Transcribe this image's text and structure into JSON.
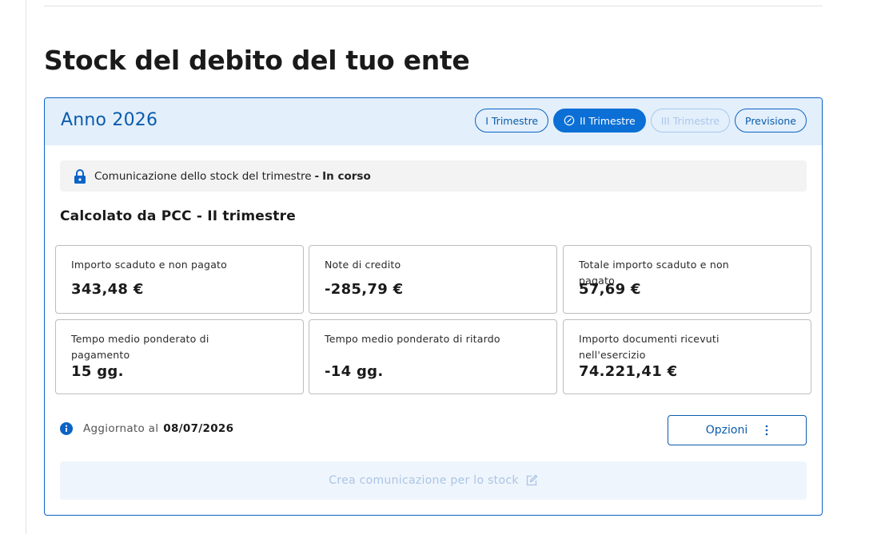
{
  "page": {
    "title": "Stock del debito del tuo ente"
  },
  "card": {
    "year_title": "Anno 2026",
    "tabs": [
      {
        "label": "I Trimestre",
        "state": "default"
      },
      {
        "label": "II Trimestre",
        "state": "active"
      },
      {
        "label": "III Trimestre",
        "state": "disabled"
      },
      {
        "label": "Previsione",
        "state": "default"
      }
    ]
  },
  "status": {
    "text": "Comunicazione dello stock del trimestre",
    "separator": "-",
    "state": "In corso",
    "icon": "lock-icon"
  },
  "section": {
    "title": "Calcolato da PCC - II trimestre"
  },
  "stats": [
    {
      "label": "Importo scaduto e non pagato",
      "value": "343,48 €"
    },
    {
      "label": "Note di credito",
      "value": "-285,79 €"
    },
    {
      "label": "Totale importo scaduto e non pagato",
      "value": "57,69 €"
    },
    {
      "label": "Tempo medio ponderato di pagamento",
      "value": "15 gg."
    },
    {
      "label": "Tempo medio ponderato di ritardo",
      "value": "-14 gg."
    },
    {
      "label": "Importo documenti ricevuti nell'esercizio",
      "value": "74.221,41 €"
    }
  ],
  "footer": {
    "updated_label": "Aggiornato al",
    "updated_date": "08/07/2026",
    "options_label": "Opzioni",
    "create_label": "Crea comunicazione per lo stock"
  },
  "colors": {
    "primary": "#0b6fd6",
    "primary_dark": "#0b5cad",
    "header_bg": "#e3effb",
    "disabled": "#a9c8ea"
  }
}
